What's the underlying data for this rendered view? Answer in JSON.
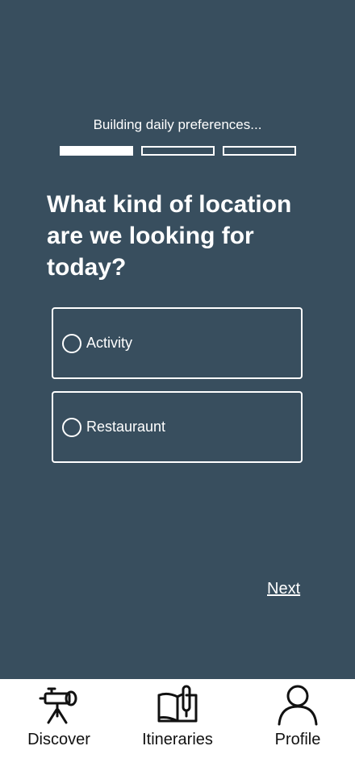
{
  "progress": {
    "label": "Building daily preferences...",
    "steps_total": 3,
    "steps_completed": 1
  },
  "question": "What kind of location are we looking for today?",
  "options": [
    {
      "label": "Activity",
      "selected": false
    },
    {
      "label": "Restauraunt",
      "selected": false
    }
  ],
  "next_label": "Next",
  "nav": {
    "items": [
      {
        "label": "Discover",
        "icon": "telescope-icon"
      },
      {
        "label": "Itineraries",
        "icon": "book-icon"
      },
      {
        "label": "Profile",
        "icon": "person-icon"
      }
    ]
  },
  "colors": {
    "background": "#384e5e",
    "foreground": "#ffffff",
    "nav_background": "#ffffff",
    "nav_text": "#111111"
  }
}
